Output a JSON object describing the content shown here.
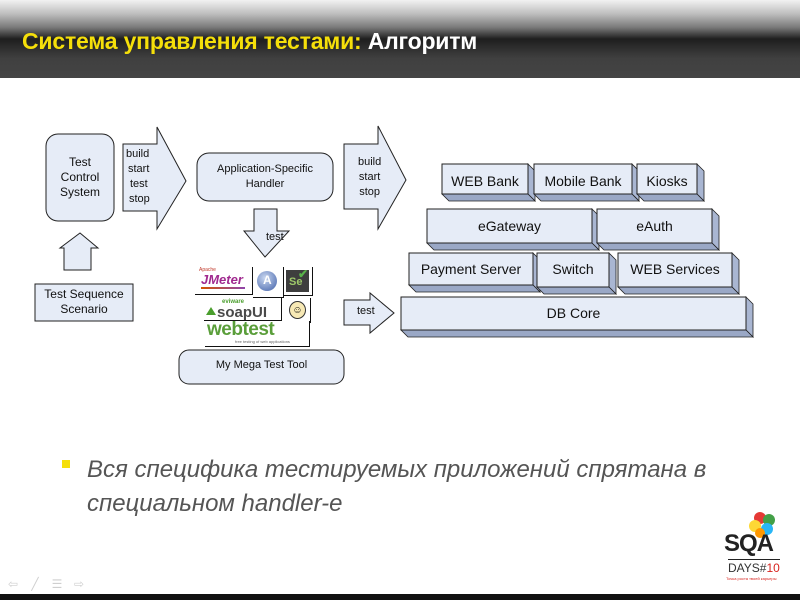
{
  "header": {
    "title_highlight": "Система управления тестами:",
    "title_rest": "Алгоритм"
  },
  "diagram": {
    "test_control_system": "Test Control System",
    "test_control_lines": [
      "Test",
      "Control",
      "System"
    ],
    "arrow1_lines": [
      "build",
      "start",
      "test",
      "stop"
    ],
    "test_sequence_lines": [
      "Test Sequence",
      "Scenario"
    ],
    "handler_lines": [
      "Application-Specific",
      "Handler"
    ],
    "down_arrow_label": "test",
    "tool_logos": [
      "JMeter",
      "AutoIt",
      "Selenium",
      "soapUI",
      "Sahi",
      "webtest"
    ],
    "soapui_prefix": "eviware",
    "soapui_label": "soapUI",
    "webtest_label": "webtest",
    "webtest_tagline": "free testing of web applications",
    "jmeter_label": "JMeter",
    "selenium_label": "Se",
    "my_tool_label": "My Mega Test Tool",
    "arrow2_lines": [
      "build",
      "start",
      "stop"
    ],
    "arrow3_label": "test",
    "system_blocks": {
      "row1": [
        "WEB Bank",
        "Mobile Bank",
        "Kiosks"
      ],
      "row2": [
        "eGateway",
        "eAuth"
      ],
      "row3": [
        "Payment Server",
        "Switch",
        "WEB Services"
      ],
      "row4": [
        "DB Core"
      ]
    }
  },
  "bullet": {
    "text": "Вся специфика тестируемых приложений спрятана в специальном handler-е"
  },
  "nav": {
    "icons": [
      "prev-arrow",
      "pen",
      "menu",
      "next-arrow"
    ],
    "glyphs": [
      "⇦",
      "╱",
      "☰",
      "⇨"
    ]
  },
  "logo": {
    "main": "SQA",
    "days": "DAYS#",
    "number": "10",
    "tagline": "Точка роста твоей карьеры"
  },
  "colors": {
    "title_yellow": "#f5df0a",
    "box_fill": "#e6ecf7",
    "box_side": "#a9b6d2",
    "bullet_yellow": "#f5df0a",
    "logo_red": "#d8231e"
  }
}
